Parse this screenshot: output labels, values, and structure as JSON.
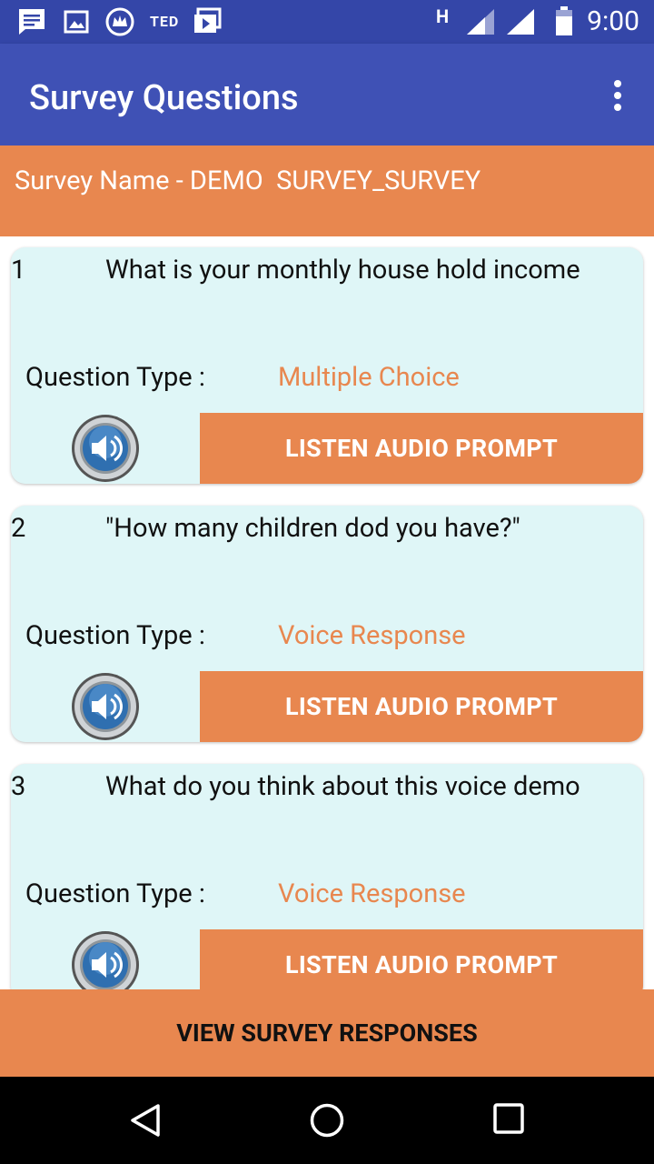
{
  "status_bar": {
    "ted": "TED",
    "network": "H",
    "time": "9:00"
  },
  "app_bar": {
    "title": "Survey Questions"
  },
  "survey": {
    "name": "Survey Name - DEMO  SURVEY_SURVEY"
  },
  "questions": [
    {
      "number": "1",
      "text": "What is your monthly house hold income",
      "type_label": "Question Type :",
      "type_value": "Multiple Choice",
      "button": "LISTEN AUDIO PROMPT"
    },
    {
      "number": "2",
      "text": "\"How many children dod you have?\"",
      "type_label": "Question Type :",
      "type_value": "Voice Response",
      "button": "LISTEN AUDIO PROMPT"
    },
    {
      "number": "3",
      "text": "What do you think about this voice demo",
      "type_label": "Question Type :",
      "type_value": "Voice Response",
      "button": "LISTEN AUDIO PROMPT"
    }
  ],
  "footer": {
    "view_responses": "VIEW SURVEY RESPONSES"
  },
  "colors": {
    "primary": "#3f51b5",
    "primary_dark": "#3446a8",
    "accent": "#e8874f",
    "card_bg": "#dff6f7"
  }
}
